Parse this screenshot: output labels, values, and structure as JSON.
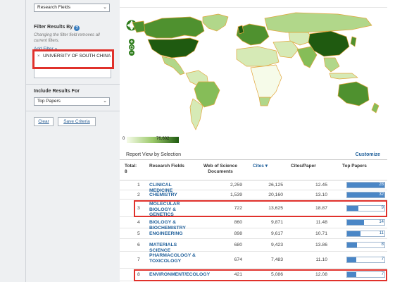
{
  "sidebar": {
    "field_select": "Research Fields",
    "filter_title": "Filter Results By",
    "filter_note": "Changing the filter field removes all current filters.",
    "add_filter": "Add Filter »",
    "filter_remove": "×",
    "active_filter": "UNIVERSITY OF SOUTH CHINA",
    "include_title": "Include Results For",
    "include_select": "Top Papers",
    "clear_button": "Clear",
    "save_button": "Save Criteria"
  },
  "map": {
    "legend_min": "0",
    "legend_max": "76,602",
    "palette": [
      "#f6fbe9",
      "#d6eab6",
      "#b1d78a",
      "#86bd58",
      "#4f912f",
      "#1f5a10"
    ],
    "border_color": "#e2a53b"
  },
  "report": {
    "title": "Report View by Selection",
    "customize": "Customize",
    "columns": {
      "total": "Total: 8",
      "field": "Research Fields",
      "wos": "Web of Science Documents",
      "cites": "Cites ▾",
      "cites_per_paper": "Cites/Paper",
      "top_papers": "Top Papers"
    },
    "rows": [
      {
        "rank": "1",
        "field": "CLINICAL MEDICINE",
        "wos": "2,259",
        "cites": "26,125",
        "cpp": "12.45",
        "top": "28",
        "fraction": 1.0
      },
      {
        "rank": "2",
        "field": "CHEMISTRY",
        "wos": "1,539",
        "cites": "20,160",
        "cpp": "13.10",
        "top": "32",
        "fraction": 1.0
      },
      {
        "rank": "3",
        "field": "MOLECULAR BIOLOGY & GENETICS",
        "wos": "722",
        "cites": "13,625",
        "cpp": "18.87",
        "top": "9",
        "fraction": 0.3
      },
      {
        "rank": "4",
        "field": "BIOLOGY & BIOCHEMISTRY",
        "wos": "860",
        "cites": "9,871",
        "cpp": "11.48",
        "top": "14",
        "fraction": 0.45
      },
      {
        "rank": "5",
        "field": "ENGINEERING",
        "wos": "898",
        "cites": "9,617",
        "cpp": "10.71",
        "top": "11",
        "fraction": 0.35
      },
      {
        "rank": "6",
        "field": "MATERIALS SCIENCE",
        "wos": "680",
        "cites": "9,423",
        "cpp": "13.86",
        "top": "8",
        "fraction": 0.27
      },
      {
        "rank": "7",
        "field": "PHARMACOLOGY & TOXICOLOGY",
        "wos": "674",
        "cites": "7,483",
        "cpp": "11.10",
        "top": "7",
        "fraction": 0.24
      },
      {
        "rank": "8",
        "field": "ENVIRONMENT/ECOLOGY",
        "wos": "421",
        "cites": "5,086",
        "cpp": "12.08",
        "top": "7",
        "fraction": 0.24
      }
    ]
  }
}
